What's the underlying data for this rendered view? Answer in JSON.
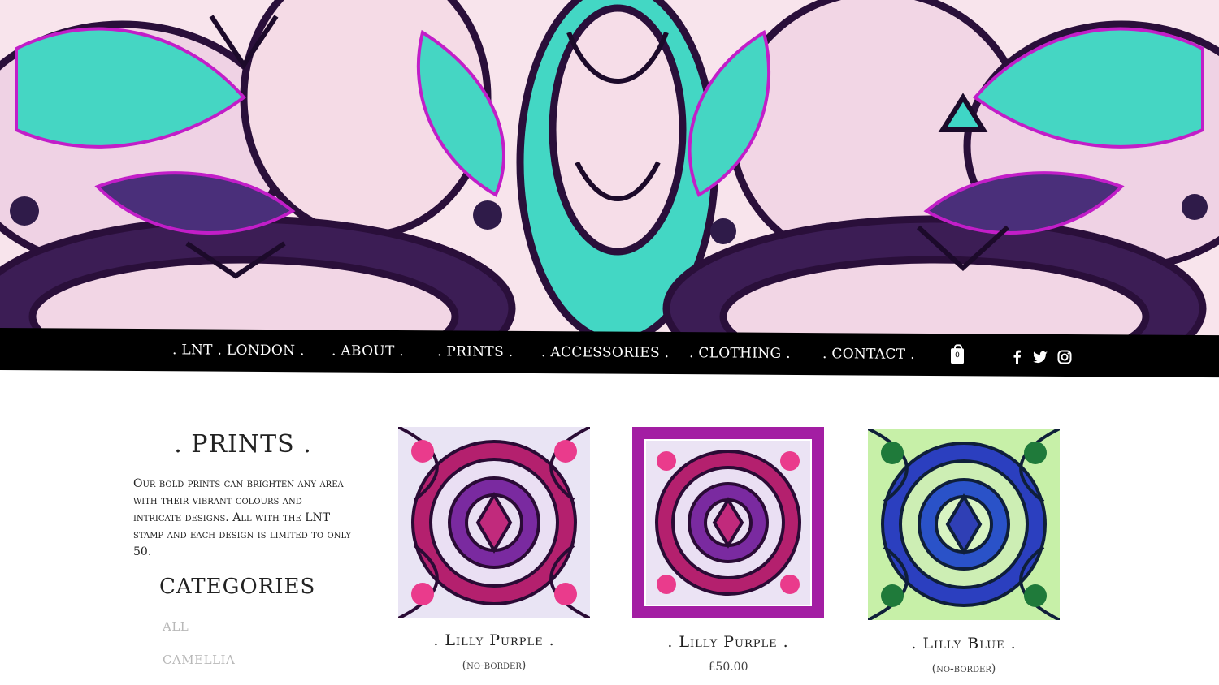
{
  "nav": {
    "items": [
      {
        "label": ". LNT . LONDON ."
      },
      {
        "label": ". ABOUT ."
      },
      {
        "label": ". PRINTS ."
      },
      {
        "label": ". ACCESSORIES ."
      },
      {
        "label": ". CLOTHING ."
      },
      {
        "label": ". CONTACT ."
      }
    ],
    "cart_count": "0",
    "social": [
      "facebook-icon",
      "twitter-icon",
      "instagram-icon"
    ]
  },
  "sidebar": {
    "title": ". PRINTS .",
    "description": "Our bold prints can brighten any area with their vibrant colours and intricate designs. All with the LNT stamp and each design is limited to only 50.",
    "categories_title": "CATEGORIES",
    "categories": [
      {
        "label": "ALL"
      },
      {
        "label": "CAMELLIA"
      }
    ]
  },
  "products": [
    {
      "name": ". Lilly Purple .",
      "sub": "(no-border)"
    },
    {
      "name": ". Lilly Purple .",
      "sub": "£50.00"
    },
    {
      "name": ". Lilly Blue .",
      "sub": "(no-border)"
    }
  ],
  "colors": {
    "nav_bg": "#000000",
    "accent_purple": "#8a1a8f",
    "accent_teal": "#3fd6c6",
    "muted_link": "#b8b8b8"
  }
}
